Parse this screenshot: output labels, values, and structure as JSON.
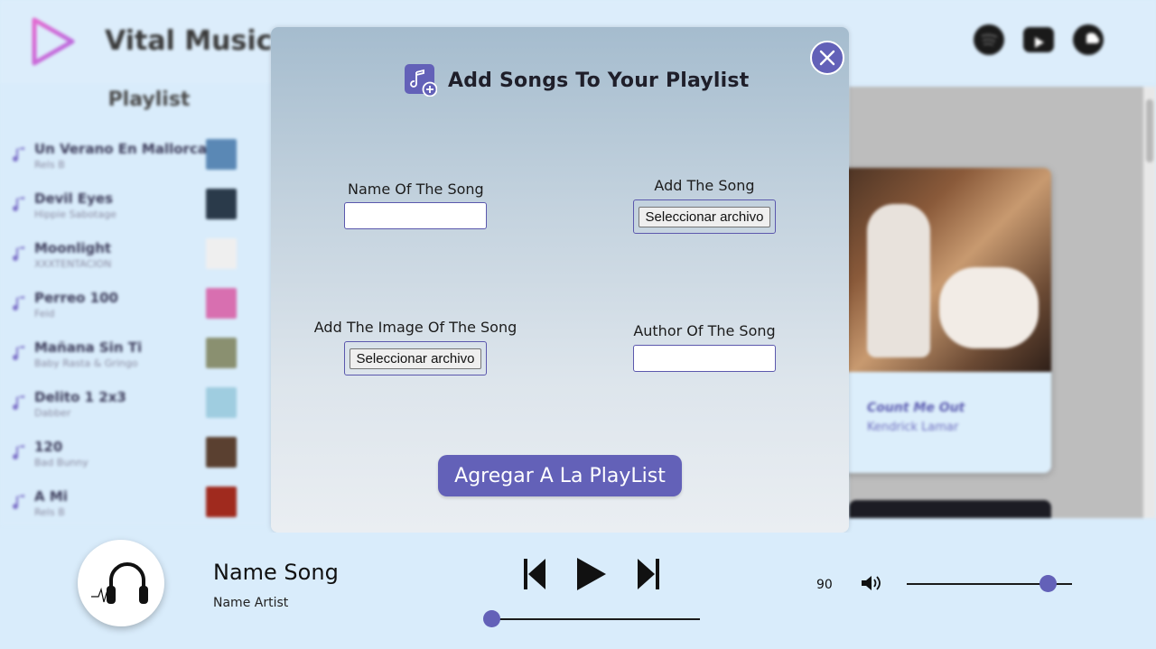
{
  "app": {
    "brand": "Vital Music",
    "social_icons": [
      "spotify-icon",
      "youtube-icon",
      "soundcloud-icon"
    ]
  },
  "playlist": {
    "title": "Playlist",
    "items": [
      {
        "title": "Un Verano En Mallorca",
        "artist": "Rels B",
        "thumb": "#5a88b5"
      },
      {
        "title": "Devil Eyes",
        "artist": "Hippie Sabotage",
        "thumb": "#2a3a4a"
      },
      {
        "title": "Moonlight",
        "artist": "XXXTENTACION",
        "thumb": "#efefef"
      },
      {
        "title": "Perreo 100",
        "artist": "Feid",
        "thumb": "#d86fb0"
      },
      {
        "title": "Mañana Sin Ti",
        "artist": "Baby Rasta & Gringo",
        "thumb": "#8a9070"
      },
      {
        "title": "Delito 1 2x3",
        "artist": "Dabber",
        "thumb": "#9fcde0"
      },
      {
        "title": "120",
        "artist": "Bad Bunny",
        "thumb": "#5a4030"
      },
      {
        "title": "A Mi",
        "artist": "Rels B",
        "thumb": "#a02a1e"
      }
    ]
  },
  "gallery": {
    "card_title": "Count Me Out",
    "card_artist": "Kendrick Lamar"
  },
  "modal": {
    "title": "Add Songs To Your Playlist",
    "fields": {
      "song_name_label": "Name Of The Song",
      "song_name_value": "",
      "add_song_label": "Add The Song",
      "add_image_label": "Add The Image Of The Song",
      "author_label": "Author Of The Song",
      "author_value": "",
      "file_button_label": "Seleccionar archivo"
    },
    "submit_label": "Agregar A La PlayList"
  },
  "player": {
    "song_name": "Name Song",
    "artist_name": "Name Artist",
    "volume": "90",
    "progress_fraction": 0,
    "volume_fraction": 0.9
  },
  "colors": {
    "accent": "#6361b8",
    "background": "#d9ecfb"
  }
}
